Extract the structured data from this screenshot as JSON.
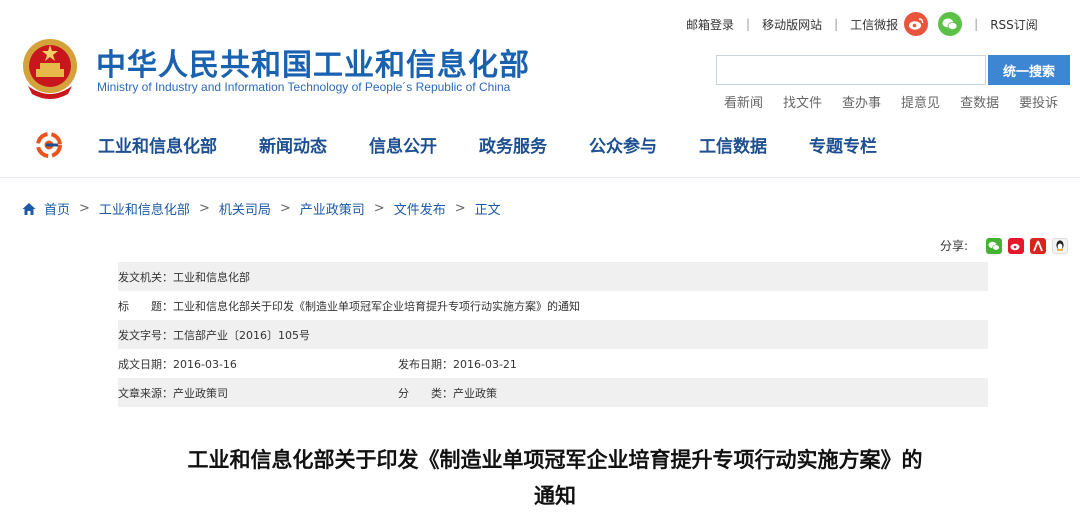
{
  "header": {
    "title": "中华人民共和国工业和信息化部",
    "subtitle": "Ministry of Industry and Information Technology of People´s Republic of China"
  },
  "toplinks": {
    "mail": "邮箱登录",
    "mobile": "移动版网站",
    "weibo": "工信微报",
    "rss": "RSS订阅"
  },
  "search": {
    "placeholder": "",
    "button": "统一搜索"
  },
  "quicklinks": [
    "看新闻",
    "找文件",
    "查办事",
    "提意见",
    "查数据",
    "要投诉"
  ],
  "nav": [
    "工业和信息化部",
    "新闻动态",
    "信息公开",
    "政务服务",
    "公众参与",
    "工信数据",
    "专题专栏"
  ],
  "breadcrumb": [
    "首页",
    "工业和信息化部",
    "机关司局",
    "产业政策司",
    "文件发布",
    "正文"
  ],
  "share": {
    "label": "分享:"
  },
  "meta": {
    "issuer": "发文机关：工业和信息化部",
    "title": "标　　题：工业和信息化部关于印发《制造业单项冠军企业培育提升专项行动实施方案》的通知",
    "docno": "发文字号：工信部产业〔2016〕105号",
    "date_made": "成文日期：2016-03-16",
    "date_pub": "发布日期：2016-03-21",
    "source": "文章来源：产业政策司",
    "category": "分　　类：产业政策"
  },
  "article": {
    "title_line1": "工业和信息化部关于印发《制造业单项冠军企业培育提升专项行动实施方案》的",
    "title_line2": "通知"
  },
  "colors": {
    "brand_blue": "#1a62b0",
    "nav_blue": "#1d4f91",
    "search_button": "#3d86d4",
    "weibo": "#e8543c",
    "wechat": "#5cc247"
  }
}
